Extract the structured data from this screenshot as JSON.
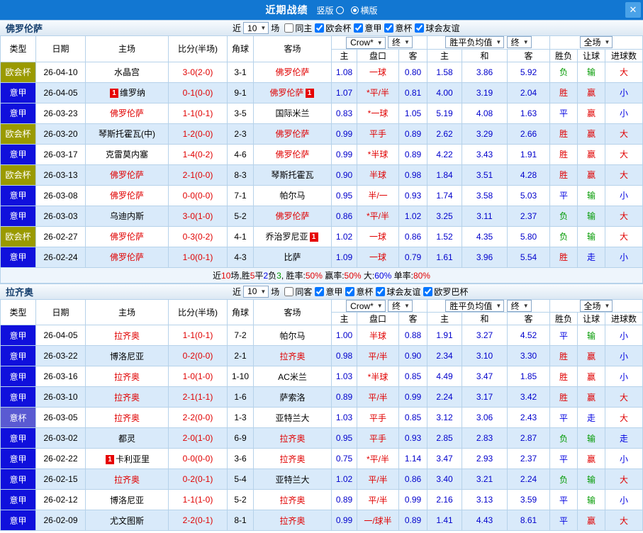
{
  "colors": {
    "topbar_bg": "#1277d2",
    "close_bg": "#4aa2e8",
    "grid_border": "#b6d2ea",
    "row_alt_bg": "#d9eafa",
    "odds_text": "#0000cc",
    "score_text": "#e00000",
    "focal_team_text": "#e00000",
    "badge_bg": "#e60000",
    "type_colors": {
      "欧会杯": "#9a9a00",
      "意甲": "#1010dc",
      "意杯": "#5a5ad2"
    },
    "value_colors": {
      "胜": "#e00000",
      "平": "#0000e0",
      "负": "#009900",
      "赢": "#e00000",
      "输": "#009900",
      "走": "#0000e0",
      "大": "#e00000",
      "小": "#0000e0"
    },
    "segment_colors": {
      "k": "#000000",
      "r": "#e00000",
      "b": "#0000e0",
      "g": "#009900"
    }
  },
  "top_bar": {
    "title": "近期战绩",
    "radios": [
      {
        "label": "竖版",
        "checked": false
      },
      {
        "label": "横版",
        "checked": true
      }
    ],
    "close_label": "✕"
  },
  "table_headers": {
    "type": "类型",
    "date": "日期",
    "home": "主场",
    "score": "比分(半场)",
    "corner": "角球",
    "away": "客场",
    "odds_home": "主",
    "odds_line": "盘口",
    "odds_away": "客",
    "avg_home": "主",
    "avg_draw": "和",
    "avg_away": "客",
    "result": "胜负",
    "handicap": "让球",
    "goals": "进球数"
  },
  "sections": [
    {
      "team": "佛罗伦萨",
      "near_label": "近",
      "count": "10",
      "unit_label": "场",
      "filters": [
        {
          "label": "同主",
          "checked": false
        },
        {
          "label": "欧会杯",
          "checked": true
        },
        {
          "label": "意甲",
          "checked": true
        },
        {
          "label": "意杯",
          "checked": true
        },
        {
          "label": "球会友谊",
          "checked": true
        }
      ],
      "selects": {
        "company": "Crow*",
        "final_a": "终",
        "avg": "胜平负均值",
        "final_b": "终",
        "scope": "全场"
      },
      "rows": [
        {
          "type": "欧会杯",
          "date": "26-04-10",
          "home": {
            "name": "水晶宫"
          },
          "score": "3-0(2-0)",
          "corner": "3-1",
          "away": {
            "name": "佛罗伦萨",
            "focal": true
          },
          "odds_home": "1.08",
          "line": "一球",
          "odds_away": "0.80",
          "avg_home": "1.58",
          "avg_draw": "3.86",
          "avg_away": "5.92",
          "result": "负",
          "handicap_result": "输",
          "goals_result": "大"
        },
        {
          "type": "意甲",
          "date": "26-04-05",
          "home": {
            "name": "维罗纳",
            "badge": "1",
            "badge_pos": "pre"
          },
          "score": "0-1(0-0)",
          "corner": "9-1",
          "away": {
            "name": "佛罗伦萨",
            "focal": true,
            "badge": "1",
            "badge_pos": "post"
          },
          "odds_home": "1.07",
          "line": "*平/半",
          "odds_away": "0.81",
          "avg_home": "4.00",
          "avg_draw": "3.19",
          "avg_away": "2.04",
          "result": "胜",
          "handicap_result": "赢",
          "goals_result": "小"
        },
        {
          "type": "意甲",
          "date": "26-03-23",
          "home": {
            "name": "佛罗伦萨",
            "focal": true
          },
          "score": "1-1(0-1)",
          "corner": "3-5",
          "away": {
            "name": "国际米兰"
          },
          "odds_home": "0.83",
          "line": "*一球",
          "odds_away": "1.05",
          "avg_home": "5.19",
          "avg_draw": "4.08",
          "avg_away": "1.63",
          "result": "平",
          "handicap_result": "赢",
          "goals_result": "小"
        },
        {
          "type": "欧会杯",
          "date": "26-03-20",
          "home": {
            "name": "琴斯托霍瓦(中)"
          },
          "score": "1-2(0-0)",
          "corner": "2-3",
          "away": {
            "name": "佛罗伦萨",
            "focal": true
          },
          "odds_home": "0.99",
          "line": "平手",
          "odds_away": "0.89",
          "avg_home": "2.62",
          "avg_draw": "3.29",
          "avg_away": "2.66",
          "result": "胜",
          "handicap_result": "赢",
          "goals_result": "大"
        },
        {
          "type": "意甲",
          "date": "26-03-17",
          "home": {
            "name": "克雷莫内塞"
          },
          "score": "1-4(0-2)",
          "corner": "4-6",
          "away": {
            "name": "佛罗伦萨",
            "focal": true
          },
          "odds_home": "0.99",
          "line": "*半球",
          "odds_away": "0.89",
          "avg_home": "4.22",
          "avg_draw": "3.43",
          "avg_away": "1.91",
          "result": "胜",
          "handicap_result": "赢",
          "goals_result": "大"
        },
        {
          "type": "欧会杯",
          "date": "26-03-13",
          "home": {
            "name": "佛罗伦萨",
            "focal": true
          },
          "score": "2-1(0-0)",
          "corner": "8-3",
          "away": {
            "name": "琴斯托霍瓦"
          },
          "odds_home": "0.90",
          "line": "半球",
          "odds_away": "0.98",
          "avg_home": "1.84",
          "avg_draw": "3.51",
          "avg_away": "4.28",
          "result": "胜",
          "handicap_result": "赢",
          "goals_result": "大"
        },
        {
          "type": "意甲",
          "date": "26-03-08",
          "home": {
            "name": "佛罗伦萨",
            "focal": true
          },
          "score": "0-0(0-0)",
          "corner": "7-1",
          "away": {
            "name": "帕尔马"
          },
          "odds_home": "0.95",
          "line": "半/一",
          "odds_away": "0.93",
          "avg_home": "1.74",
          "avg_draw": "3.58",
          "avg_away": "5.03",
          "result": "平",
          "handicap_result": "输",
          "goals_result": "小"
        },
        {
          "type": "意甲",
          "date": "26-03-03",
          "home": {
            "name": "乌迪内斯"
          },
          "score": "3-0(1-0)",
          "corner": "5-2",
          "away": {
            "name": "佛罗伦萨",
            "focal": true
          },
          "odds_home": "0.86",
          "line": "*平/半",
          "odds_away": "1.02",
          "avg_home": "3.25",
          "avg_draw": "3.11",
          "avg_away": "2.37",
          "result": "负",
          "handicap_result": "输",
          "goals_result": "大"
        },
        {
          "type": "欧会杯",
          "date": "26-02-27",
          "home": {
            "name": "佛罗伦萨",
            "focal": true
          },
          "score": "0-3(0-2)",
          "corner": "4-1",
          "away": {
            "name": "乔治罗尼亚",
            "badge": "1",
            "badge_pos": "post"
          },
          "odds_home": "1.02",
          "line": "一球",
          "odds_away": "0.86",
          "avg_home": "1.52",
          "avg_draw": "4.35",
          "avg_away": "5.80",
          "result": "负",
          "handicap_result": "输",
          "goals_result": "大"
        },
        {
          "type": "意甲",
          "date": "26-02-24",
          "home": {
            "name": "佛罗伦萨",
            "focal": true
          },
          "score": "1-0(0-1)",
          "corner": "4-3",
          "away": {
            "name": "比萨"
          },
          "odds_home": "1.09",
          "line": "一球",
          "odds_away": "0.79",
          "avg_home": "1.61",
          "avg_draw": "3.96",
          "avg_away": "5.54",
          "result": "胜",
          "handicap_result": "走",
          "goals_result": "小"
        }
      ],
      "summary": [
        {
          "t": "近",
          "c": "k"
        },
        {
          "t": "10",
          "c": "r"
        },
        {
          "t": "场,胜",
          "c": "k"
        },
        {
          "t": "5",
          "c": "r"
        },
        {
          "t": "平",
          "c": "k"
        },
        {
          "t": "2",
          "c": "b"
        },
        {
          "t": "负",
          "c": "k"
        },
        {
          "t": "3",
          "c": "g"
        },
        {
          "t": ", 胜率:",
          "c": "k"
        },
        {
          "t": "50%",
          "c": "r"
        },
        {
          "t": " 赢率:",
          "c": "k"
        },
        {
          "t": "50%",
          "c": "r"
        },
        {
          "t": " 大:",
          "c": "k"
        },
        {
          "t": "60%",
          "c": "b"
        },
        {
          "t": " 单率:",
          "c": "k"
        },
        {
          "t": "80%",
          "c": "r"
        }
      ]
    },
    {
      "team": "拉齐奥",
      "near_label": "近",
      "count": "10",
      "unit_label": "场",
      "filters": [
        {
          "label": "同客",
          "checked": false
        },
        {
          "label": "意甲",
          "checked": true
        },
        {
          "label": "意杯",
          "checked": true
        },
        {
          "label": "球会友谊",
          "checked": true
        },
        {
          "label": "欧罗巴杯",
          "checked": true
        }
      ],
      "selects": {
        "company": "Crow*",
        "final_a": "终",
        "avg": "胜平负均值",
        "final_b": "终",
        "scope": "全场"
      },
      "rows": [
        {
          "type": "意甲",
          "date": "26-04-05",
          "home": {
            "name": "拉齐奥",
            "focal": true
          },
          "score": "1-1(0-1)",
          "corner": "7-2",
          "away": {
            "name": "帕尔马"
          },
          "odds_home": "1.00",
          "line": "半球",
          "odds_away": "0.88",
          "avg_home": "1.91",
          "avg_draw": "3.27",
          "avg_away": "4.52",
          "result": "平",
          "handicap_result": "输",
          "goals_result": "小"
        },
        {
          "type": "意甲",
          "date": "26-03-22",
          "home": {
            "name": "博洛尼亚"
          },
          "score": "0-2(0-0)",
          "corner": "2-1",
          "away": {
            "name": "拉齐奥",
            "focal": true
          },
          "odds_home": "0.98",
          "line": "平/半",
          "odds_away": "0.90",
          "avg_home": "2.34",
          "avg_draw": "3.10",
          "avg_away": "3.30",
          "result": "胜",
          "handicap_result": "赢",
          "goals_result": "小"
        },
        {
          "type": "意甲",
          "date": "26-03-16",
          "home": {
            "name": "拉齐奥",
            "focal": true
          },
          "score": "1-0(1-0)",
          "corner": "1-10",
          "away": {
            "name": "AC米兰"
          },
          "odds_home": "1.03",
          "line": "*半球",
          "odds_away": "0.85",
          "avg_home": "4.49",
          "avg_draw": "3.47",
          "avg_away": "1.85",
          "result": "胜",
          "handicap_result": "赢",
          "goals_result": "小"
        },
        {
          "type": "意甲",
          "date": "26-03-10",
          "home": {
            "name": "拉齐奥",
            "focal": true
          },
          "score": "2-1(1-1)",
          "corner": "1-6",
          "away": {
            "name": "萨索洛"
          },
          "odds_home": "0.89",
          "line": "平/半",
          "odds_away": "0.99",
          "avg_home": "2.24",
          "avg_draw": "3.17",
          "avg_away": "3.42",
          "result": "胜",
          "handicap_result": "赢",
          "goals_result": "大"
        },
        {
          "type": "意杯",
          "date": "26-03-05",
          "home": {
            "name": "拉齐奥",
            "focal": true
          },
          "score": "2-2(0-0)",
          "corner": "1-3",
          "away": {
            "name": "亚特兰大"
          },
          "odds_home": "1.03",
          "line": "平手",
          "odds_away": "0.85",
          "avg_home": "3.12",
          "avg_draw": "3.06",
          "avg_away": "2.43",
          "result": "平",
          "handicap_result": "走",
          "goals_result": "大"
        },
        {
          "type": "意甲",
          "date": "26-03-02",
          "home": {
            "name": "都灵"
          },
          "score": "2-0(1-0)",
          "corner": "6-9",
          "away": {
            "name": "拉齐奥",
            "focal": true
          },
          "odds_home": "0.95",
          "line": "平手",
          "odds_away": "0.93",
          "avg_home": "2.85",
          "avg_draw": "2.83",
          "avg_away": "2.87",
          "result": "负",
          "handicap_result": "输",
          "goals_result": "走"
        },
        {
          "type": "意甲",
          "date": "26-02-22",
          "home": {
            "name": "卡利亚里",
            "badge": "1",
            "badge_pos": "pre"
          },
          "score": "0-0(0-0)",
          "corner": "3-6",
          "away": {
            "name": "拉齐奥",
            "focal": true
          },
          "odds_home": "0.75",
          "line": "*平/半",
          "odds_away": "1.14",
          "avg_home": "3.47",
          "avg_draw": "2.93",
          "avg_away": "2.37",
          "result": "平",
          "handicap_result": "赢",
          "goals_result": "小"
        },
        {
          "type": "意甲",
          "date": "26-02-15",
          "home": {
            "name": "拉齐奥",
            "focal": true
          },
          "score": "0-2(0-1)",
          "corner": "5-4",
          "away": {
            "name": "亚特兰大"
          },
          "odds_home": "1.02",
          "line": "平/半",
          "odds_away": "0.86",
          "avg_home": "3.40",
          "avg_draw": "3.21",
          "avg_away": "2.24",
          "result": "负",
          "handicap_result": "输",
          "goals_result": "大"
        },
        {
          "type": "意甲",
          "date": "26-02-12",
          "home": {
            "name": "博洛尼亚"
          },
          "score": "1-1(1-0)",
          "corner": "5-2",
          "away": {
            "name": "拉齐奥",
            "focal": true
          },
          "odds_home": "0.89",
          "line": "平/半",
          "odds_away": "0.99",
          "avg_home": "2.16",
          "avg_draw": "3.13",
          "avg_away": "3.59",
          "result": "平",
          "handicap_result": "输",
          "goals_result": "小"
        },
        {
          "type": "意甲",
          "date": "26-02-09",
          "home": {
            "name": "尤文图斯"
          },
          "score": "2-2(0-1)",
          "corner": "8-1",
          "away": {
            "name": "拉齐奥",
            "focal": true
          },
          "odds_home": "0.99",
          "line": "一/球半",
          "odds_away": "0.89",
          "avg_home": "1.41",
          "avg_draw": "4.43",
          "avg_away": "8.61",
          "result": "平",
          "handicap_result": "赢",
          "goals_result": "大"
        }
      ]
    }
  ]
}
